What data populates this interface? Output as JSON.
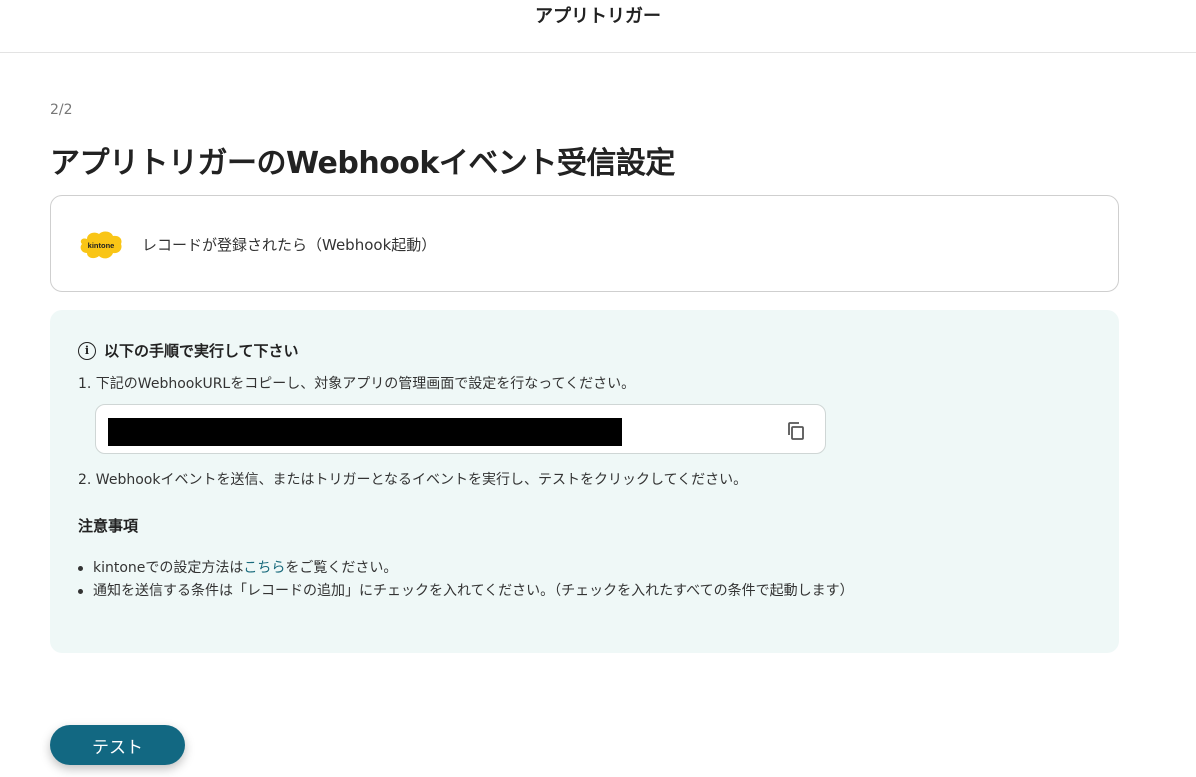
{
  "header": {
    "title": "アプリトリガー"
  },
  "step_indicator": "2/2",
  "page_title": "アプリトリガーのWebhookイベント受信設定",
  "trigger": {
    "logo_text": "kintone",
    "logo_color": "#f9c516",
    "label": "レコードが登録されたら（Webhook起動）"
  },
  "instructions": {
    "heading": "以下の手順で実行して下さい",
    "info_icon_glyph": "i",
    "step1": "1. 下記のWebhookURLをコピーし、対象アプリの管理画面で設定を行なってください。",
    "step2": "2. Webhookイベントを送信、またはトリガーとなるイベントを実行し、テストをクリックしてください。",
    "url_value": "",
    "copy_icon": "copy-icon"
  },
  "notes": {
    "heading": "注意事項",
    "item1_prefix": "kintoneでの設定方法は",
    "item1_link": "こちら",
    "item1_suffix": "をご覧ください。",
    "item2": "通知を送信する条件は「レコードの追加」にチェックを入れてください。（チェックを入れたすべての条件で起動します）"
  },
  "actions": {
    "test_label": "テスト"
  },
  "colors": {
    "accent": "#126882",
    "panel_bg": "#eff8f7",
    "link": "#1a6b7d"
  }
}
